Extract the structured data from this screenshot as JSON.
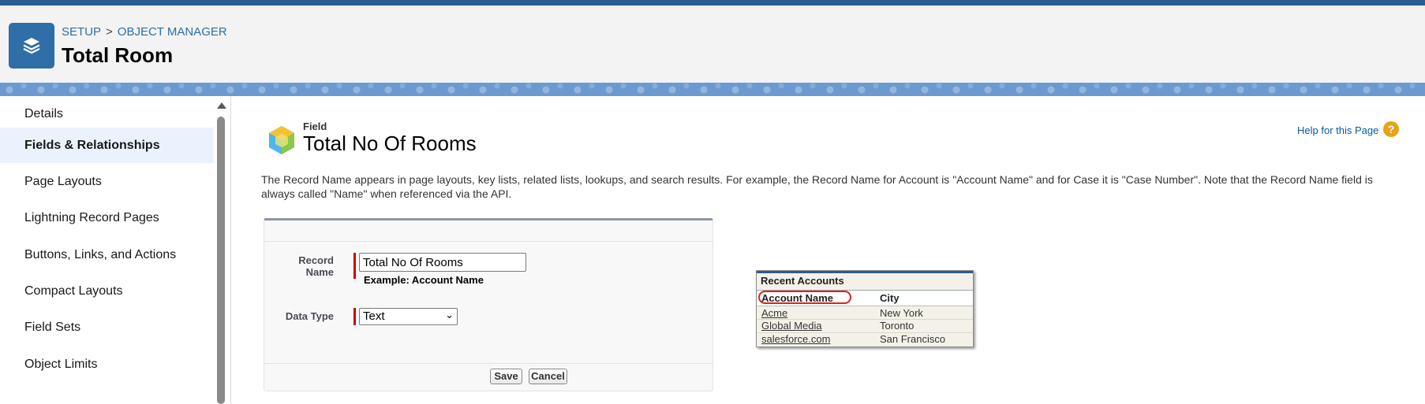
{
  "header": {
    "breadcrumb": [
      "SETUP",
      "OBJECT MANAGER"
    ],
    "breadcrumb_separator": ">",
    "title": "Total Room",
    "icon": "stack-layers-icon"
  },
  "sidebar": {
    "items": [
      {
        "label": "Details"
      },
      {
        "label": "Fields & Relationships",
        "active": true
      },
      {
        "label": "Page Layouts"
      },
      {
        "label": "Lightning Record Pages"
      },
      {
        "label": "Buttons, Links, and Actions"
      },
      {
        "label": "Compact Layouts"
      },
      {
        "label": "Field Sets"
      },
      {
        "label": "Object Limits"
      }
    ]
  },
  "main": {
    "field_label": "Field",
    "field_title": "Total No Of Rooms",
    "help_link": "Help for this Page",
    "help_icon_glyph": "?",
    "description": "The Record Name appears in page layouts, key lists, related lists, lookups, and search results. For example, the Record Name for Account is \"Account Name\" and for Case it is \"Case Number\". Note that the Record Name field is always called \"Name\" when referenced via the API."
  },
  "form": {
    "record_name_label": "Record Name",
    "record_name_value": "Total No Of Rooms",
    "example_text": "Example:  Account Name",
    "data_type_label": "Data Type",
    "data_type_value": "Text",
    "save_label": "Save",
    "cancel_label": "Cancel"
  },
  "preview": {
    "title": "Recent Accounts",
    "headers": [
      "Account Name",
      "City"
    ],
    "rows": [
      [
        "Acme",
        "New York"
      ],
      [
        "Global Media",
        "Toronto"
      ],
      [
        "salesforce.com",
        "San Francisco"
      ]
    ]
  },
  "colors": {
    "brand": "#2f6ea6",
    "active_nav_bg": "#eaf3fd",
    "required": "#cc0000",
    "help_icon": "#e8a317"
  }
}
